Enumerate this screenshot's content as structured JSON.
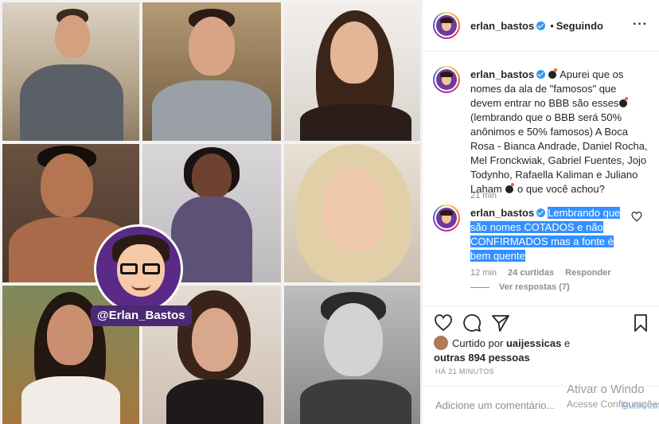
{
  "collage": {
    "watermark_handle": "@Erlan_Bastos"
  },
  "header": {
    "username": "erlan_bastos",
    "separator": "•",
    "follow_status": "Seguindo",
    "more_icon": "more-options-icon"
  },
  "caption": {
    "username": "erlan_bastos",
    "text_1": "Apurei que os nomes da ala de \"famosos\" que devem entrar no BBB são esses",
    "text_2": "(lembrando que o BBB será 50% anônimos e 50% famosos) A Boca Rosa - Bianca Andrade, Daniel Rocha, Mel Fronckwiak, Gabriel Fuentes, Jojo Todynho, Rafaella Kaliman e Juliano Laham",
    "text_3": "o que você achou?",
    "time": "21 min"
  },
  "comment": {
    "username": "erlan_bastos",
    "text": "Lembrando que são nomes COTADOS e não CONFIRMADOS mas a fonte é bem quente",
    "time": "12 min",
    "likes": "24 curtidas",
    "reply_label": "Responder",
    "view_replies": "Ver respostas (7)"
  },
  "actions": {
    "like_icon": "heart-icon",
    "comment_icon": "comment-icon",
    "share_icon": "share-icon",
    "save_icon": "bookmark-icon"
  },
  "likes": {
    "prefix": "Curtido por",
    "user": "uaijessicas",
    "connector": "e",
    "others": "outras 894 pessoas"
  },
  "posted_ago": "HÁ 21 MINUTOS",
  "add_comment": {
    "placeholder": "Adicione um comentário...",
    "publish_label": "Publicar"
  },
  "windows_watermark": {
    "line1": "Ativar o Windo",
    "line2": "Acesse Configurações"
  },
  "colors": {
    "verified": "#3897f0",
    "selection": "#3390ff",
    "logo_purple": "#5b2a86"
  }
}
